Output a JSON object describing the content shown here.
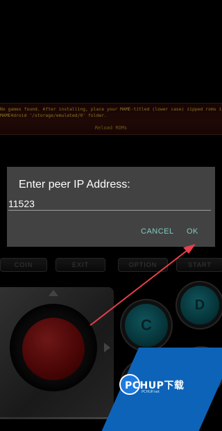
{
  "banner": {
    "message_line1": "No games found. After installing, place your MAME-titled (lower case) zipped roms in",
    "message_line2": "MAME4droid '/storage/emulated/0' folder.",
    "reload_label": "Reload ROMs"
  },
  "controller": {
    "coin_label": "COIN",
    "exit_label": "EXIT",
    "option_label": "OPTION",
    "start_label": "START",
    "button_c_label": "C",
    "button_d_label": "D"
  },
  "dialog": {
    "title": "Enter peer IP Address:",
    "input_value": "11523",
    "cancel_label": "CANCEL",
    "ok_label": "OK"
  },
  "watermark": {
    "brand": "PCHUP下载",
    "sub": "PCHUP.net"
  },
  "colors": {
    "dialog_bg": "#424242",
    "accent": "#80cbc4",
    "annotation_arrow": "#e8404a"
  }
}
